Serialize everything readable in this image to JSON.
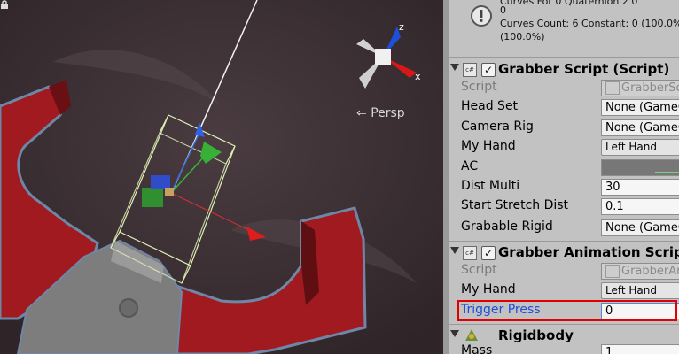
{
  "scene": {
    "view_label": "Persp",
    "gizmo": {
      "y_axis": "z",
      "x_axis": "x"
    }
  },
  "inspector": {
    "info_box": {
      "line1": "Curves For 0 Quaternion 2 0",
      "line2": "0",
      "line3": "Curves Count: 6 Constant: 0 (100.0%)",
      "line4": "(100.0%)"
    },
    "grabber_script": {
      "title": "Grabber Script (Script)",
      "rows": {
        "script": {
          "label": "Script",
          "value": "GrabberScript"
        },
        "head_set": {
          "label": "Head Set",
          "value": "None (GameObject)"
        },
        "camera_rig": {
          "label": "Camera Rig",
          "value": "None (GameObject)"
        },
        "my_hand": {
          "label": "My Hand",
          "value": "Left Hand"
        },
        "ac": {
          "label": "AC"
        },
        "dist_multi": {
          "label": "Dist Multi",
          "value": "30"
        },
        "start_stretch": {
          "label": "Start Stretch Dist",
          "value": "0.1"
        },
        "grabable_rigid": {
          "label": "Grabable Rigid",
          "value": "None (GameObject)"
        }
      }
    },
    "grabber_anim": {
      "title": "Grabber Animation Script (Script)",
      "rows": {
        "script": {
          "label": "Script",
          "value": "GrabberAnimationScript"
        },
        "my_hand": {
          "label": "My Hand",
          "value": "Left Hand"
        },
        "trigger_press": {
          "label": "Trigger Press",
          "value": "0"
        }
      }
    },
    "rigidbody": {
      "title": "Rigidbody",
      "rows": {
        "mass": {
          "label": "Mass",
          "value": "1"
        }
      }
    }
  },
  "colors": {
    "highlight_border": "#e00000",
    "active_label": "#1f4ed8",
    "scene_bg": "#3b2f33"
  }
}
